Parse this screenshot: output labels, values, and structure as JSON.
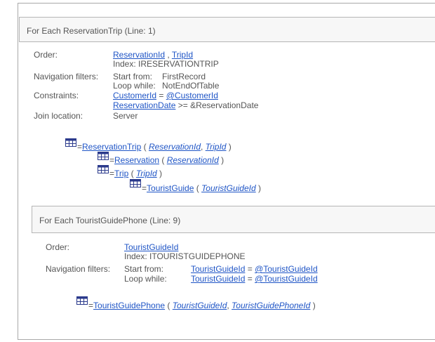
{
  "block1": {
    "header": "For Each ReservationTrip (Line: 1)",
    "order_label": "Order:",
    "order_attr1": "ReservationId",
    "order_sep": " , ",
    "order_attr2": "TripId",
    "index_text": "Index: IRESERVATIONTRIP",
    "nav_label": "Navigation filters:",
    "start_label": "Start from:",
    "start_value": "FirstRecord",
    "loop_label": "Loop while:",
    "loop_value": "NotEndOfTable",
    "constraints_label": "Constraints:",
    "constraint1_left": "CustomerId",
    "constraint1_op": " = ",
    "constraint1_right": "@CustomerId",
    "constraint2_left": "ReservationDate",
    "constraint2_rest": " >= &ReservationDate",
    "join_label": "Join location:",
    "join_value": "Server",
    "tree": {
      "t1_name": "ReservationTrip",
      "t1_open": " ( ",
      "t1_k1": "ReservationId",
      "t1_sep": ", ",
      "t1_k2": "TripId",
      "t1_close": " )",
      "t2_name": "Reservation",
      "t2_open": " ( ",
      "t2_k1": "ReservationId",
      "t2_close": " )",
      "t3_name": "Trip",
      "t3_open": " ( ",
      "t3_k1": "TripId",
      "t3_close": " )",
      "t4_name": "TouristGuide",
      "t4_open": " ( ",
      "t4_k1": "TouristGuideId",
      "t4_close": " )"
    }
  },
  "block2": {
    "header": "For Each TouristGuidePhone (Line: 9)",
    "order_label": "Order:",
    "order_attr1": "TouristGuideId",
    "index_text": "Index: ITOURISTGUIDEPHONE",
    "nav_label": "Navigation filters:",
    "start_label": "Start from:",
    "start_left": "TouristGuideId",
    "start_op": " = ",
    "start_right": "@TouristGuideId",
    "loop_label": "Loop while:",
    "loop_left": "TouristGuideId",
    "loop_op": " = ",
    "loop_right": "@TouristGuideId",
    "tree": {
      "t1_name": "TouristGuidePhone",
      "t1_open": " ( ",
      "t1_k1": "TouristGuideId",
      "t1_sep": ", ",
      "t1_k2": "TouristGuidePhoneId",
      "t1_close": " )"
    }
  },
  "eq_sign": "=",
  "icons": {
    "table": "table-icon"
  },
  "colors": {
    "link": "#1f55c6",
    "text": "#555555",
    "icon": "#2b3a8c"
  }
}
